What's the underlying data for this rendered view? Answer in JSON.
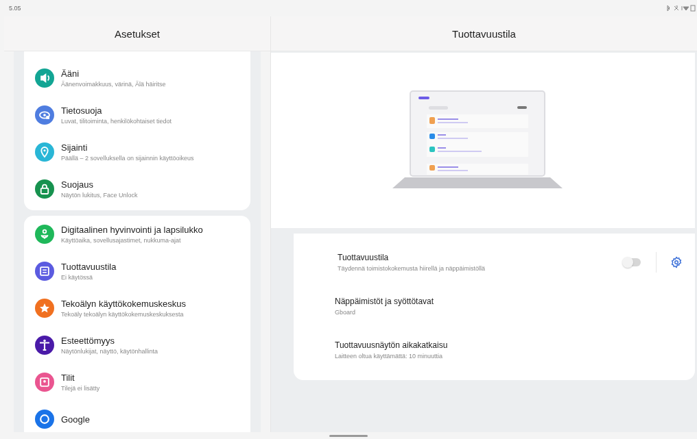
{
  "status_bar": {
    "time": "5.05"
  },
  "left_pane": {
    "title": "Asetukset",
    "groups": [
      {
        "items": [
          {
            "title": "Ääni",
            "subtitle": "Äänenvoimakkuus, värinä, Älä häiritse",
            "color": "#12a594",
            "selected": false
          },
          {
            "title": "Tietosuoja",
            "subtitle": "Luvat, tilitoiminta, henkilökohtaiset tiedot",
            "color": "#4f7de0",
            "selected": false
          },
          {
            "title": "Sijainti",
            "subtitle": "Päällä – 2 sovelluksella on sijainnin käyttöoikeus",
            "color": "#29b6d6",
            "selected": false
          },
          {
            "title": "Suojaus",
            "subtitle": "Näytön lukitus, Face Unlock",
            "color": "#17924f",
            "selected": false
          }
        ]
      },
      {
        "items": [
          {
            "title": "Digitaalinen hyvinvointi ja lapsilukko",
            "subtitle": "Käyttöaika, sovellusajastimet, nukkuma-ajat",
            "color": "#1fb85a",
            "selected": false
          },
          {
            "title": "Tuottavuustila",
            "subtitle": "Ei käytössä",
            "color": "#5b5be0",
            "selected": false
          },
          {
            "title": "Tekoälyn käyttökokemuskeskus",
            "subtitle": "Tekoäly tekoälyn käyttökokemuskeskuksesta",
            "color": "#f07020",
            "selected": false
          },
          {
            "title": "Esteettömyys",
            "subtitle": "Näytönlukijat, näyttö, käytönhallinta",
            "color": "#4a1aa8",
            "selected": false
          },
          {
            "title": "Tilit",
            "subtitle": "Tilejä ei lisätty",
            "color": "#ea5590",
            "selected": false
          },
          {
            "title": "Google",
            "color": "#1a73e8",
            "selected": false
          }
        ]
      }
    ]
  },
  "right_pane": {
    "title": "Tuottavuustila",
    "settings": [
      {
        "kind": "toggle",
        "title": "Tuottavuustila",
        "subtitle": "Täydennä toimistokokemusta hiirellä ja näppäimistöllä",
        "on": false
      },
      {
        "kind": "link",
        "title": "Näppäimistöt ja syöttötavat",
        "subtitle": "Gboard"
      },
      {
        "kind": "link",
        "title": "Tuottavuusnäytön aikakatkaisu",
        "subtitle": "Laitteen oltua käyttämättä: 10 minuuttia"
      }
    ]
  }
}
